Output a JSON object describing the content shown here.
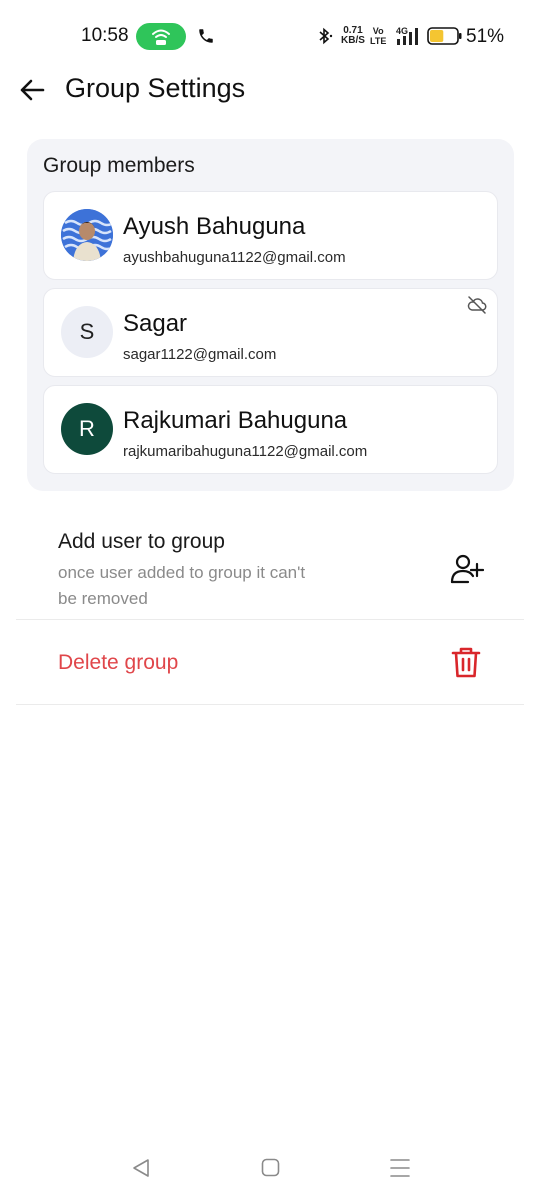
{
  "status_bar": {
    "time": "10:58",
    "net_speed_value": "0.71",
    "net_speed_unit": "KB/S",
    "volte_top": "Vo",
    "volte_bottom": "LTE",
    "network_type": "4G",
    "battery_percent": "51%",
    "icons": [
      "hotspot-icon",
      "call-icon",
      "bluetooth-icon",
      "signal-icon",
      "battery-icon"
    ],
    "hotspot_color": "#2fc55a",
    "battery_fill_color": "#f4c531",
    "battery_level": 0.51
  },
  "header": {
    "title": "Group Settings",
    "back_icon": "arrow-left-icon"
  },
  "members": {
    "heading": "Group members",
    "items": [
      {
        "name": "Ayush Bahuguna",
        "email": "ayushbahuguna1122@gmail.com",
        "avatar": "photo",
        "initial": ""
      },
      {
        "name": "Sagar",
        "email": "sagar1122@gmail.com",
        "avatar": "initial-light",
        "initial": "S",
        "status_icon": "cloud-off-icon"
      },
      {
        "name": "Rajkumari Bahuguna",
        "email": "rajkumaribahuguna1122@gmail.com",
        "avatar": "initial-dark",
        "initial": "R"
      }
    ]
  },
  "actions": {
    "add_user": {
      "title": "Add user to group",
      "subtitle": "once user added to group it can't be removed",
      "icon": "add-user-icon"
    },
    "delete_group": {
      "label": "Delete group",
      "icon": "trash-icon",
      "color": "#e0464a"
    }
  },
  "nav_bar": {
    "icons": [
      "nav-back-icon",
      "nav-home-icon",
      "nav-menu-icon"
    ]
  }
}
